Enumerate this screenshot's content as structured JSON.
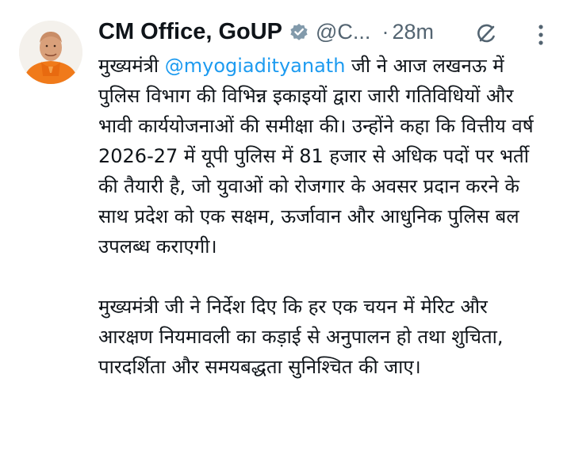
{
  "tweet": {
    "display_name": "CM Office, GoUP",
    "handle": "@C...",
    "separator": "·",
    "time": "28m",
    "verified_icon": "verified-badge-gray",
    "grok_icon": "grok-icon",
    "more_icon": "more-vertical-icon",
    "colors": {
      "text": "#0f1419",
      "muted": "#536471",
      "link": "#1d9bf0",
      "badge": "#829aab"
    },
    "paragraph1": {
      "prefix": "मुख्यमंत्री ",
      "mention": "@myogiadityanath",
      "suffix": " जी ने आज लखनऊ में पुलिस विभाग की विभिन्न इकाइयों द्वारा जारी गतिविधियों और भावी कार्ययोजनाओं की समीक्षा की। उन्होंने कहा कि वित्तीय वर्ष 2026-27 में यूपी पुलिस में 81 हजार से अधिक पदों पर भर्ती की तैयारी है, जो युवाओं को रोजगार के अवसर प्रदान करने के साथ प्रदेश को एक सक्षम, ऊर्जावान और आधुनिक पुलिस बल उपलब्ध कराएगी।"
    },
    "paragraph2": "मुख्यमंत्री जी ने निर्देश दिए कि हर एक चयन में मेरिट और आरक्षण नियमावली का कड़ाई से अनुपालन हो तथा शुचिता, पारदर्शिता और समयबद्धता सुनिश्चित की जाए।"
  }
}
